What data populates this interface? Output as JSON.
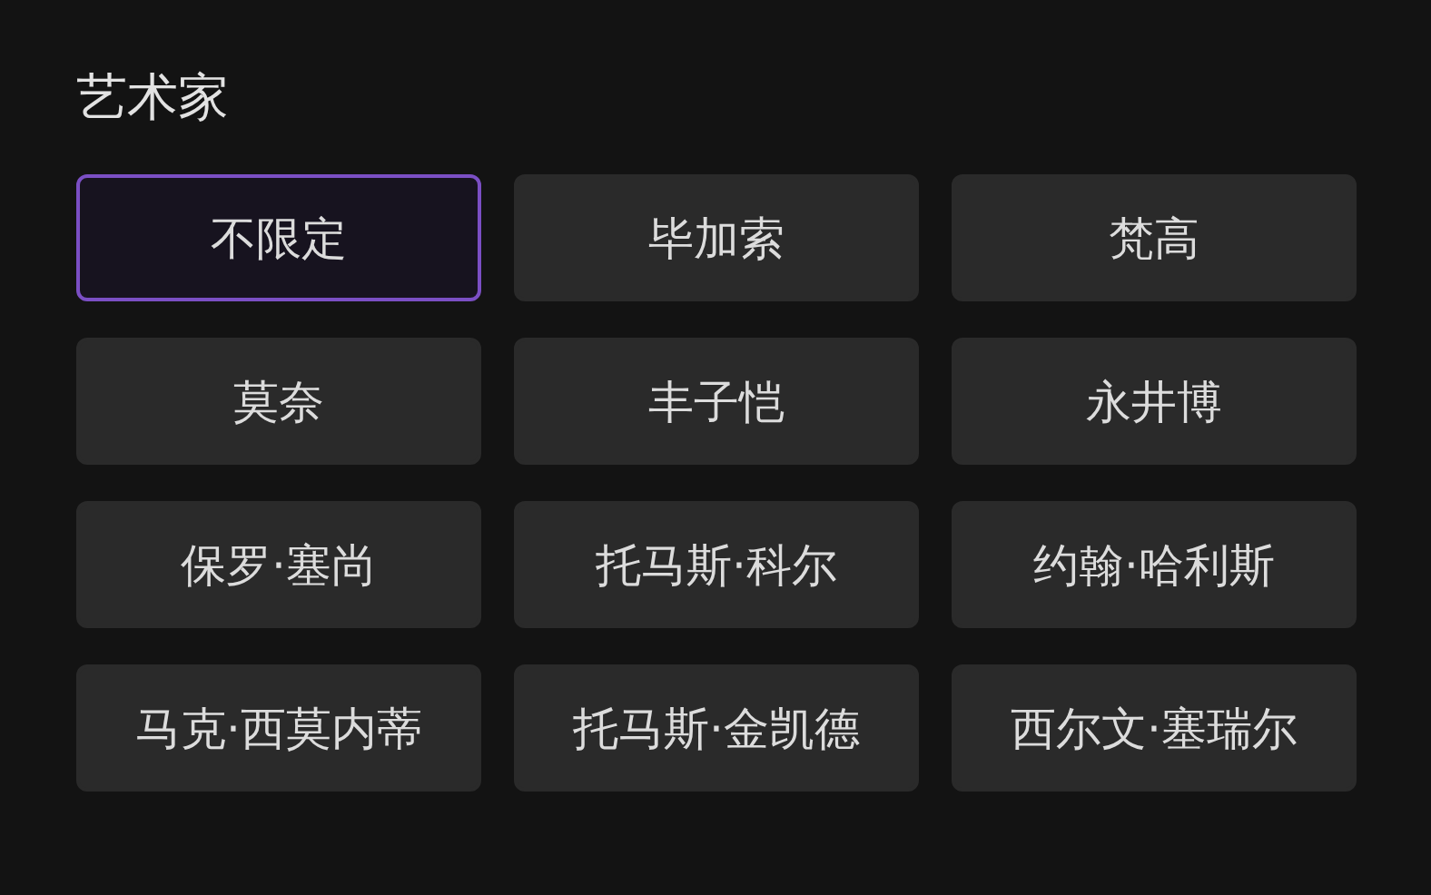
{
  "section": {
    "title": "艺术家"
  },
  "options": [
    {
      "label": "不限定",
      "selected": true
    },
    {
      "label": "毕加索",
      "selected": false
    },
    {
      "label": "梵高",
      "selected": false
    },
    {
      "label": "莫奈",
      "selected": false
    },
    {
      "label": "丰子恺",
      "selected": false
    },
    {
      "label": "永井博",
      "selected": false
    },
    {
      "label": "保罗·塞尚",
      "selected": false
    },
    {
      "label": "托马斯·科尔",
      "selected": false
    },
    {
      "label": "约翰·哈利斯",
      "selected": false
    },
    {
      "label": "马克·西莫内蒂",
      "selected": false
    },
    {
      "label": "托马斯·金凯德",
      "selected": false
    },
    {
      "label": "西尔文·塞瑞尔",
      "selected": false
    }
  ]
}
